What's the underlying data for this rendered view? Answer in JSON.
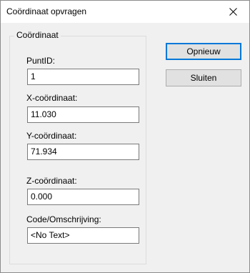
{
  "window": {
    "title": "Coördinaat opvragen",
    "close_icon": "close-icon"
  },
  "groupbox": {
    "label": "Coördinaat"
  },
  "fields": {
    "punt_id": {
      "label": "PuntID:",
      "value": "1"
    },
    "x": {
      "label": "X-coördinaat:",
      "value": "11.030"
    },
    "y": {
      "label": "Y-coördinaat:",
      "value": "71.934"
    },
    "z": {
      "label": "Z-coördinaat:",
      "value": "0.000"
    },
    "code": {
      "label": "Code/Omschrijving:",
      "value": "<No Text>"
    }
  },
  "buttons": {
    "opnieuw": "Opnieuw",
    "sluiten": "Sluiten"
  },
  "colors": {
    "dialog_background": "#f0f0f0",
    "default_button_border": "#0078d7"
  }
}
